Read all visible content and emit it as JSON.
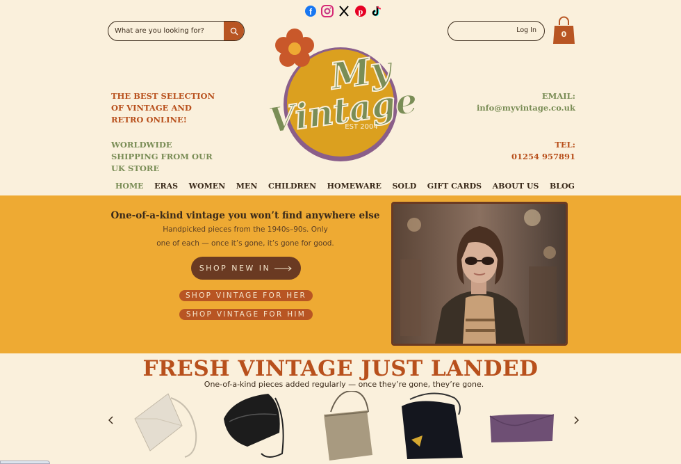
{
  "social": [
    {
      "name": "facebook-icon",
      "color": "#1877f2"
    },
    {
      "name": "instagram-icon",
      "color": "#d62976"
    },
    {
      "name": "x-icon",
      "color": "#000000"
    },
    {
      "name": "pinterest-icon",
      "color": "#e60023"
    },
    {
      "name": "tiktok-icon",
      "color": "#000000"
    }
  ],
  "search": {
    "placeholder": "What are you looking for?"
  },
  "header": {
    "login_label": "Log In",
    "cart_count": "0",
    "tagline_1": "THE BEST SELECTION OF VINTAGE AND RETRO ONLINE!",
    "tagline_2": "WORLDWIDE SHIPPING FROM OUR UK STORE",
    "email_label": "EMAIL:",
    "email_value": "info@myvintage.co.uk",
    "tel_label": "TEL:",
    "tel_value": "01254 957891"
  },
  "logo": {
    "line1": "My",
    "line2": "Vintage",
    "est": "EST 2004"
  },
  "nav": [
    "HOME",
    "ERAS",
    "WOMEN",
    "MEN",
    "CHILDREN",
    "HOMEWARE",
    "SOLD",
    "GIFT CARDS",
    "ABOUT US",
    "BLOG"
  ],
  "hero": {
    "heading": "One-of-a-kind vintage you won’t find anywhere else",
    "sub1": "Handpicked pieces from the 1940s–90s. Only",
    "sub2": "one of each — once it’s gone, it’s gone for good.",
    "cta_main": "SHOP NEW IN",
    "cta_her": "SHOP VINTAGE FOR HER",
    "cta_him": "SHOP VINTAGE FOR HIM"
  },
  "fresh": {
    "title": "FRESH VINTAGE JUST LANDED",
    "subtitle": "One-of-a-kind pieces added regularly — once they’re gone, they’re gone."
  },
  "colors": {
    "accent": "#b8501c",
    "olive": "#7a8d56",
    "hero_bg": "#eeaa33",
    "cream": "#faf0dc",
    "brown": "#6a3a22"
  }
}
